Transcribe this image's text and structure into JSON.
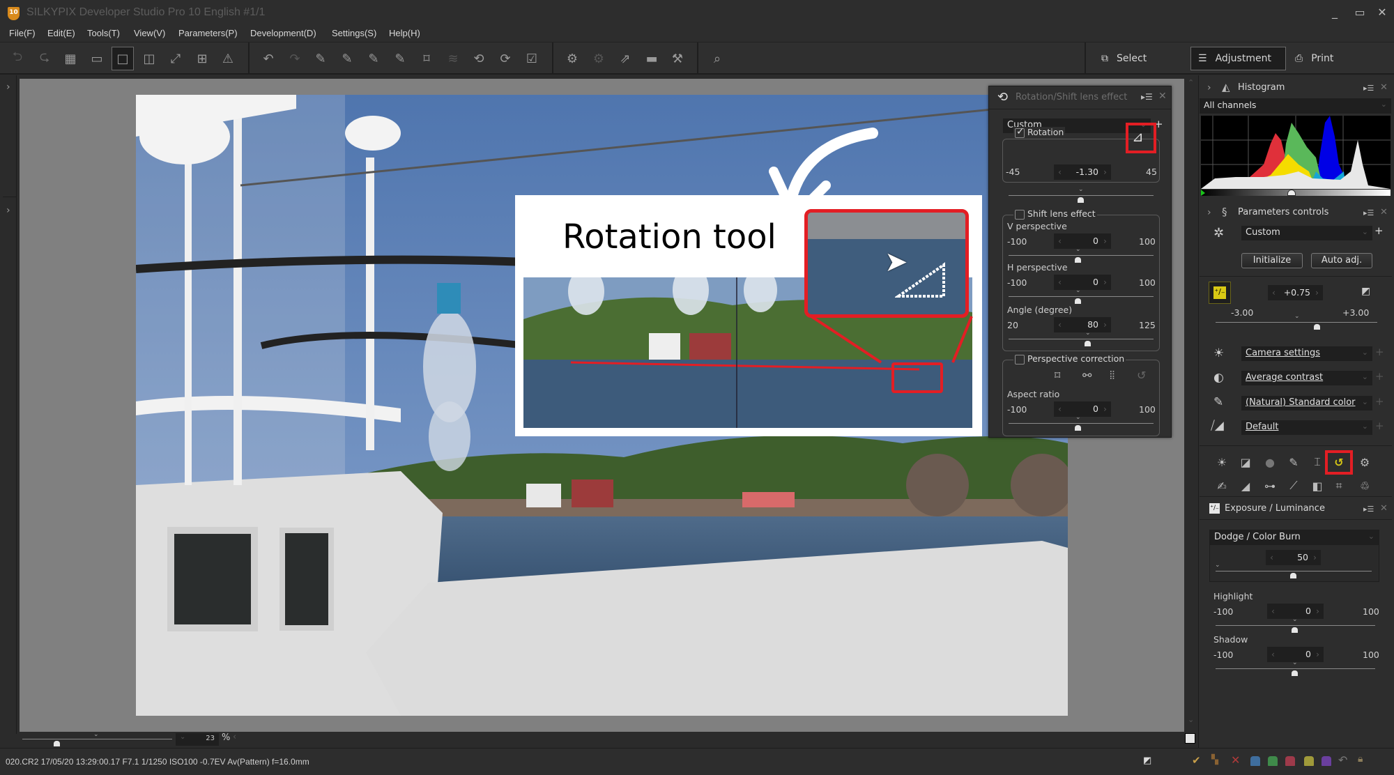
{
  "window": {
    "title": "SILKYPIX Developer Studio Pro 10 English   #1/1",
    "logo_text": "10",
    "minimize_icon": "_",
    "maximize_icon": "▭",
    "close_icon": "✕"
  },
  "menu": [
    "File(F)",
    "Edit(E)",
    "Tools(T)",
    "View(V)",
    "Parameters(P)",
    "Development(D)",
    "Settings(S)",
    "Help(H)"
  ],
  "toolbar": {
    "modes": {
      "select": "Select",
      "adjustment": "Adjustment",
      "print": "Print"
    },
    "active_mode": "Adjustment"
  },
  "canvas": {
    "overlay_title": "Rotation tool",
    "zoom_value": "23",
    "zoom_unit": "%",
    "zoom_slider_fraction": 0.23
  },
  "status": {
    "exif": "020.CR2 17/05/20 13:29:00.17 F7.1 1/1250 ISO100 -0.7EV Av(Pattern) f=16.0mm",
    "label_colors": [
      "#3f6e9e",
      "#3f8a4a",
      "#9e3a4a",
      "#a09a3a",
      "#6a3f9e"
    ]
  },
  "rotation_panel": {
    "title": "Rotation/Shift lens effect",
    "preset": "Custom",
    "rotation": {
      "label": "Rotation",
      "checked": true,
      "min": "-45",
      "max": "45",
      "value": "-1.30",
      "fraction": 0.486
    },
    "shift": {
      "label": "Shift lens effect",
      "checked": false,
      "v_perspective": {
        "label": "V perspective",
        "min": "-100",
        "max": "100",
        "value": "0"
      },
      "h_perspective": {
        "label": "H perspective",
        "min": "-100",
        "max": "100",
        "value": "0"
      },
      "angle": {
        "label": "Angle (degree)",
        "min": "20",
        "max": "125",
        "value": "80"
      }
    },
    "perspective": {
      "label": "Perspective correction",
      "checked": false,
      "aspect": {
        "label": "Aspect ratio",
        "min": "-100",
        "max": "100",
        "value": "0"
      }
    }
  },
  "histogram": {
    "title": "Histogram",
    "channel": "All channels"
  },
  "params": {
    "title": "Parameters controls",
    "preset": "Custom",
    "initialize": "Initialize",
    "auto_adj": "Auto adj.",
    "exposure": {
      "value": "+0.75",
      "min": "-3.00",
      "max": "+3.00",
      "fraction": 0.625
    },
    "white_balance": "Camera settings",
    "tone": "Average contrast",
    "color": "(Natural) Standard color",
    "sharpness": "Default"
  },
  "exposure_panel": {
    "title": "Exposure / Luminance",
    "dodge": {
      "label": "Dodge / Color Burn",
      "value": "50"
    },
    "highlight": {
      "label": "Highlight",
      "min": "-100",
      "max": "100",
      "value": "0"
    },
    "shadow": {
      "label": "Shadow",
      "min": "-100",
      "max": "100",
      "value": "0"
    }
  }
}
